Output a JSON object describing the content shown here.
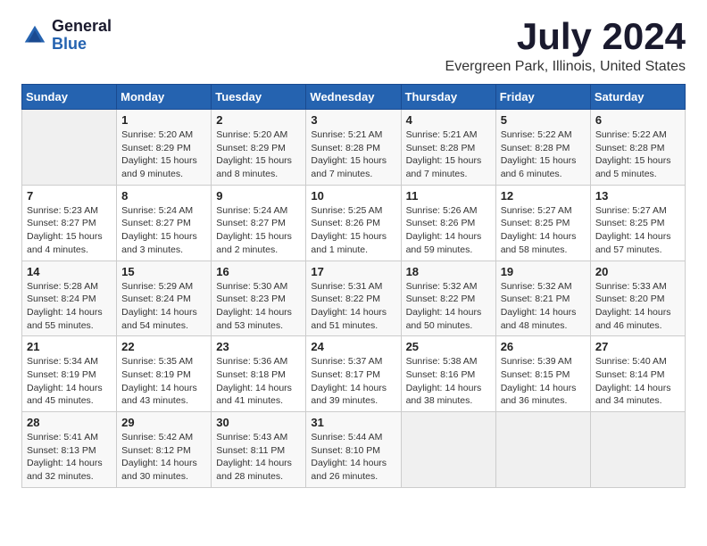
{
  "header": {
    "logo_general": "General",
    "logo_blue": "Blue",
    "title": "July 2024",
    "location": "Evergreen Park, Illinois, United States"
  },
  "days_of_week": [
    "Sunday",
    "Monday",
    "Tuesday",
    "Wednesday",
    "Thursday",
    "Friday",
    "Saturday"
  ],
  "weeks": [
    [
      {
        "day": "",
        "info": ""
      },
      {
        "day": "1",
        "info": "Sunrise: 5:20 AM\nSunset: 8:29 PM\nDaylight: 15 hours\nand 9 minutes."
      },
      {
        "day": "2",
        "info": "Sunrise: 5:20 AM\nSunset: 8:29 PM\nDaylight: 15 hours\nand 8 minutes."
      },
      {
        "day": "3",
        "info": "Sunrise: 5:21 AM\nSunset: 8:28 PM\nDaylight: 15 hours\nand 7 minutes."
      },
      {
        "day": "4",
        "info": "Sunrise: 5:21 AM\nSunset: 8:28 PM\nDaylight: 15 hours\nand 7 minutes."
      },
      {
        "day": "5",
        "info": "Sunrise: 5:22 AM\nSunset: 8:28 PM\nDaylight: 15 hours\nand 6 minutes."
      },
      {
        "day": "6",
        "info": "Sunrise: 5:22 AM\nSunset: 8:28 PM\nDaylight: 15 hours\nand 5 minutes."
      }
    ],
    [
      {
        "day": "7",
        "info": "Sunrise: 5:23 AM\nSunset: 8:27 PM\nDaylight: 15 hours\nand 4 minutes."
      },
      {
        "day": "8",
        "info": "Sunrise: 5:24 AM\nSunset: 8:27 PM\nDaylight: 15 hours\nand 3 minutes."
      },
      {
        "day": "9",
        "info": "Sunrise: 5:24 AM\nSunset: 8:27 PM\nDaylight: 15 hours\nand 2 minutes."
      },
      {
        "day": "10",
        "info": "Sunrise: 5:25 AM\nSunset: 8:26 PM\nDaylight: 15 hours\nand 1 minute."
      },
      {
        "day": "11",
        "info": "Sunrise: 5:26 AM\nSunset: 8:26 PM\nDaylight: 14 hours\nand 59 minutes."
      },
      {
        "day": "12",
        "info": "Sunrise: 5:27 AM\nSunset: 8:25 PM\nDaylight: 14 hours\nand 58 minutes."
      },
      {
        "day": "13",
        "info": "Sunrise: 5:27 AM\nSunset: 8:25 PM\nDaylight: 14 hours\nand 57 minutes."
      }
    ],
    [
      {
        "day": "14",
        "info": "Sunrise: 5:28 AM\nSunset: 8:24 PM\nDaylight: 14 hours\nand 55 minutes."
      },
      {
        "day": "15",
        "info": "Sunrise: 5:29 AM\nSunset: 8:24 PM\nDaylight: 14 hours\nand 54 minutes."
      },
      {
        "day": "16",
        "info": "Sunrise: 5:30 AM\nSunset: 8:23 PM\nDaylight: 14 hours\nand 53 minutes."
      },
      {
        "day": "17",
        "info": "Sunrise: 5:31 AM\nSunset: 8:22 PM\nDaylight: 14 hours\nand 51 minutes."
      },
      {
        "day": "18",
        "info": "Sunrise: 5:32 AM\nSunset: 8:22 PM\nDaylight: 14 hours\nand 50 minutes."
      },
      {
        "day": "19",
        "info": "Sunrise: 5:32 AM\nSunset: 8:21 PM\nDaylight: 14 hours\nand 48 minutes."
      },
      {
        "day": "20",
        "info": "Sunrise: 5:33 AM\nSunset: 8:20 PM\nDaylight: 14 hours\nand 46 minutes."
      }
    ],
    [
      {
        "day": "21",
        "info": "Sunrise: 5:34 AM\nSunset: 8:19 PM\nDaylight: 14 hours\nand 45 minutes."
      },
      {
        "day": "22",
        "info": "Sunrise: 5:35 AM\nSunset: 8:19 PM\nDaylight: 14 hours\nand 43 minutes."
      },
      {
        "day": "23",
        "info": "Sunrise: 5:36 AM\nSunset: 8:18 PM\nDaylight: 14 hours\nand 41 minutes."
      },
      {
        "day": "24",
        "info": "Sunrise: 5:37 AM\nSunset: 8:17 PM\nDaylight: 14 hours\nand 39 minutes."
      },
      {
        "day": "25",
        "info": "Sunrise: 5:38 AM\nSunset: 8:16 PM\nDaylight: 14 hours\nand 38 minutes."
      },
      {
        "day": "26",
        "info": "Sunrise: 5:39 AM\nSunset: 8:15 PM\nDaylight: 14 hours\nand 36 minutes."
      },
      {
        "day": "27",
        "info": "Sunrise: 5:40 AM\nSunset: 8:14 PM\nDaylight: 14 hours\nand 34 minutes."
      }
    ],
    [
      {
        "day": "28",
        "info": "Sunrise: 5:41 AM\nSunset: 8:13 PM\nDaylight: 14 hours\nand 32 minutes."
      },
      {
        "day": "29",
        "info": "Sunrise: 5:42 AM\nSunset: 8:12 PM\nDaylight: 14 hours\nand 30 minutes."
      },
      {
        "day": "30",
        "info": "Sunrise: 5:43 AM\nSunset: 8:11 PM\nDaylight: 14 hours\nand 28 minutes."
      },
      {
        "day": "31",
        "info": "Sunrise: 5:44 AM\nSunset: 8:10 PM\nDaylight: 14 hours\nand 26 minutes."
      },
      {
        "day": "",
        "info": ""
      },
      {
        "day": "",
        "info": ""
      },
      {
        "day": "",
        "info": ""
      }
    ]
  ]
}
